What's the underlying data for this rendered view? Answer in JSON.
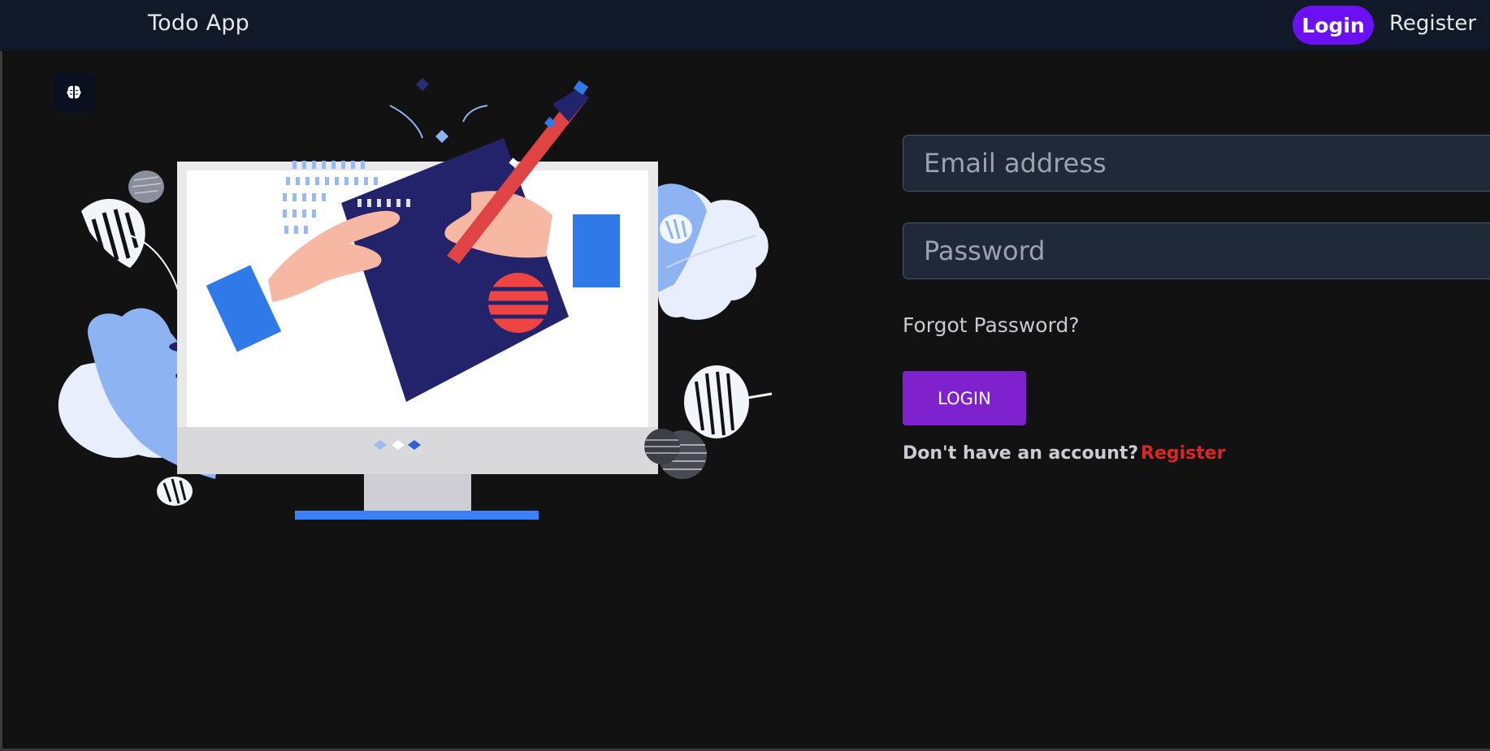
{
  "navbar": {
    "brand": "Todo App",
    "login_label": "Login",
    "register_label": "Register"
  },
  "badge": {
    "icon": "brain-icon"
  },
  "illustration": {
    "description_icon": "computer-illustration-icon"
  },
  "form": {
    "email_placeholder": "Email address",
    "password_placeholder": "Password",
    "forgot_label": "Forgot Password?",
    "login_button": "LOGIN",
    "no_account_text": "Don't have an account?",
    "register_link": "Register"
  },
  "colors": {
    "navbar_bg": "#111827",
    "accent_purple": "#6b10f2",
    "button_purple": "#7e22ce",
    "register_red": "#dc2626",
    "page_bg": "#121212"
  }
}
